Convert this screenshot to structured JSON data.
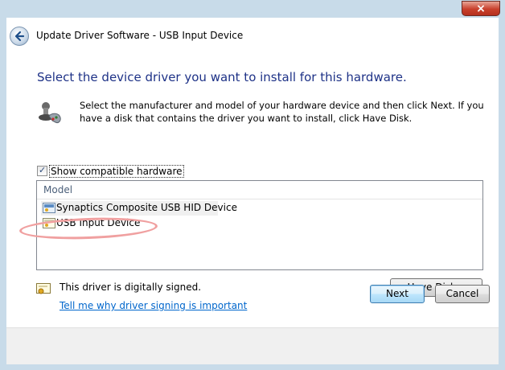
{
  "window": {
    "title": "Update Driver Software - USB Input Device",
    "close_glyph": "×"
  },
  "main": {
    "heading": "Select the device driver you want to install for this hardware.",
    "description": "Select the manufacturer and model of your hardware device and then click Next. If you have a disk that contains the driver you want to install, click Have Disk.",
    "show_compatible": {
      "label": "Show compatible hardware",
      "checked": true,
      "check_glyph": "✓"
    },
    "model_list": {
      "header": "Model",
      "items": [
        {
          "label": "Synaptics Composite USB HID Device",
          "selected": true
        },
        {
          "label": "USB Input Device",
          "selected": false
        }
      ]
    },
    "signed_text": "This driver is digitally signed.",
    "signing_link": "Tell me why driver signing is important",
    "have_disk_label": "Have Disk..."
  },
  "footer": {
    "next_label": "Next",
    "cancel_label": "Cancel"
  },
  "colors": {
    "heading": "#1e3287",
    "link": "#0066cc",
    "frame": "#c8dbe9",
    "annotation": "#f0a0a0"
  }
}
